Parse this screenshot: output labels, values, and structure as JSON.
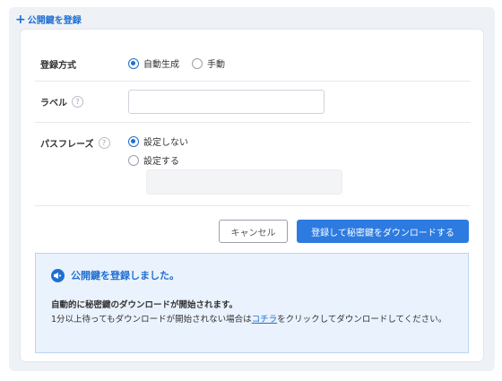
{
  "header": {
    "add_link": "公開鍵を登録"
  },
  "form": {
    "method": {
      "label": "登録方式",
      "options": [
        "自動生成",
        "手動"
      ],
      "selected": "自動生成"
    },
    "label_field": {
      "label": "ラベル",
      "value": ""
    },
    "passphrase": {
      "label": "パスフレーズ",
      "options": [
        "設定しない",
        "設定する"
      ],
      "selected": "設定しない",
      "value": ""
    }
  },
  "buttons": {
    "cancel": "キャンセル",
    "submit": "登録して秘密鍵をダウンロードする"
  },
  "notice": {
    "title": "公開鍵を登録しました。",
    "bold_line": "自動的に秘密鍵のダウンロードが開始されます。",
    "line_before": "1分以上待ってもダウンロードが開始されない場合は",
    "link": "コチラ",
    "line_after": "をクリックしてダウンロードしてください。"
  },
  "colors": {
    "accent": "#1f6fd1",
    "notice_bg": "#eaf2fd",
    "primary_button": "#2d7be0"
  }
}
